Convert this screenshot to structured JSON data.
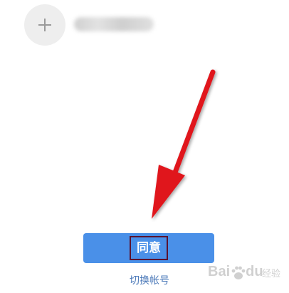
{
  "header": {
    "add_icon": "plus-icon",
    "account_name_blurred": true
  },
  "agree_button": {
    "label": "同意",
    "color": "#4a90e8",
    "highlight_border_color": "#5a1330"
  },
  "switch_account": {
    "label": "切换帐号",
    "color": "#4a78b8"
  },
  "annotation": {
    "type": "arrow",
    "color": "#e0141e",
    "points_to": "agree-button"
  },
  "watermark": {
    "text_left": "Bai",
    "text_right": "du",
    "suffix": "经验",
    "icon": "paw-icon"
  }
}
